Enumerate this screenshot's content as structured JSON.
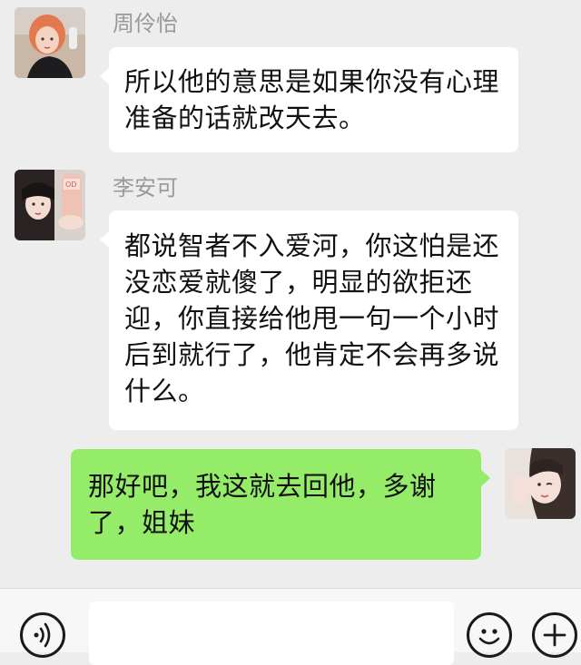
{
  "messages": [
    {
      "sender": "周伶怡",
      "side": "left",
      "lines": [
        "所以他的意思是如果你没有心理",
        "准备的话就改天去。"
      ]
    },
    {
      "sender": "李安可",
      "side": "left",
      "lines": [
        "都说智者不入爱河，你这怕是还",
        "没恋爱就傻了，明显的欲拒还",
        "迎，你直接给他甩一句一个小时",
        "后到就行了，他肯定不会再多说",
        "什么。"
      ]
    },
    {
      "sender": "",
      "side": "right",
      "lines": [
        "那好吧，我这就去回他，多谢",
        "了，姐妹"
      ]
    }
  ],
  "input_bar": {
    "voice_icon": "voice-icon",
    "emoji_icon": "emoji-icon",
    "plus_icon": "plus-icon",
    "input_value": ""
  },
  "colors": {
    "background": "#ededed",
    "left_bubble": "#ffffff",
    "right_bubble": "#95ec69",
    "sender_name": "#9a9a9a"
  }
}
